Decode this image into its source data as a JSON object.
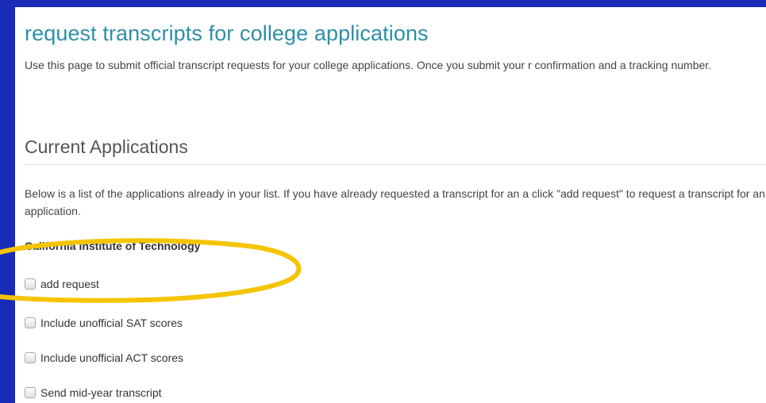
{
  "page": {
    "title": "request transcripts for college applications",
    "intro": "Use this page to submit official transcript requests for your college applications. Once you submit your r confirmation and a tracking number."
  },
  "applications": {
    "heading": "Current Applications",
    "description": "Below is a list of the applications already in your list. If you have already requested a transcript for an a click \"add request\" to request a transcript for an application.",
    "college": "California Institute of Technology",
    "options": {
      "add_request": "add request",
      "sat": "Include unofficial SAT scores",
      "act": "Include unofficial ACT scores",
      "mid_year": "Send mid-year transcript"
    }
  },
  "annotation": {
    "highlight_color": "#f5c400"
  }
}
